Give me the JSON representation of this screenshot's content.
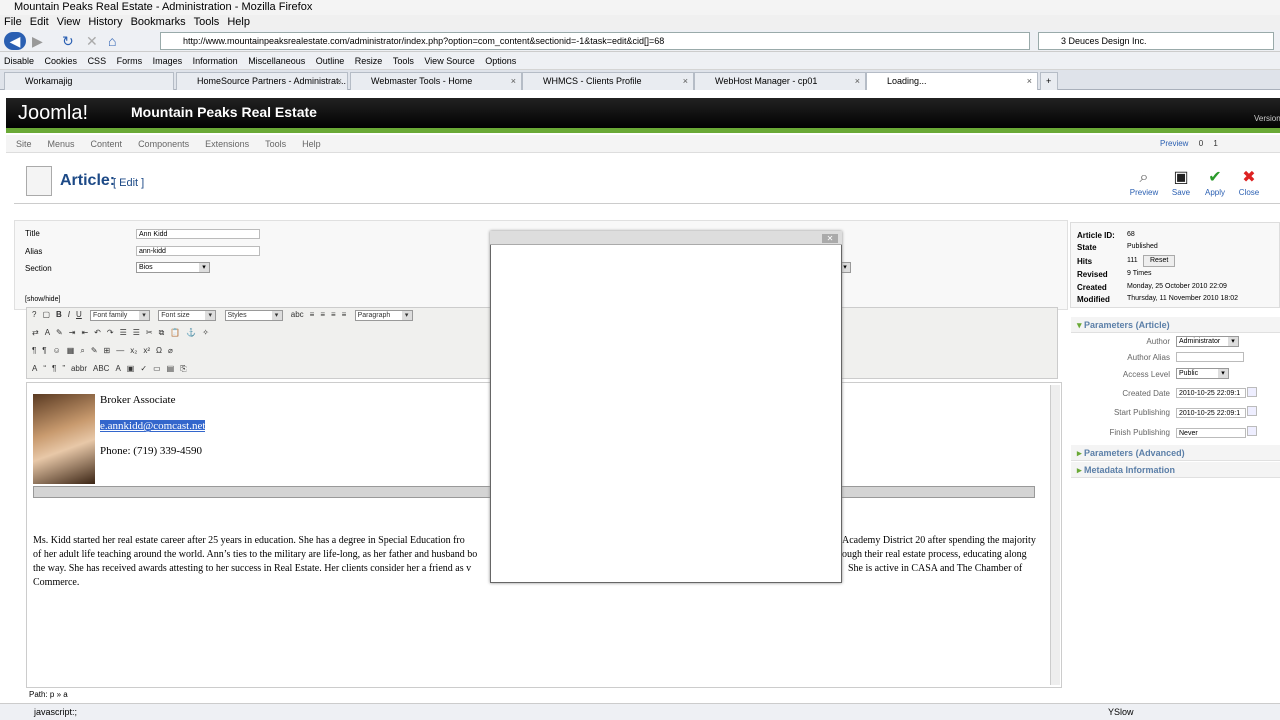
{
  "browser": {
    "title": "Mountain Peaks Real Estate - Administration - Mozilla Firefox",
    "menus": [
      "File",
      "Edit",
      "View",
      "History",
      "Bookmarks",
      "Tools",
      "Help"
    ],
    "url": "http://www.mountainpeaksrealestate.com/administrator/index.php?option=com_content&sectionid=-1&task=edit&cid[]=68",
    "search": "3 Deuces Design Inc.",
    "status_left": "javascript:;",
    "status_right": "YSlow"
  },
  "webdev": [
    "Disable",
    "Cookies",
    "CSS",
    "Forms",
    "Images",
    "Information",
    "Miscellaneous",
    "Outline",
    "Resize",
    "Tools",
    "View Source",
    "Options"
  ],
  "tabs": [
    "Workamajig",
    "HomeSource Partners - Administrat...",
    "Webmaster Tools - Home",
    "WHMCS - Clients Profile",
    "WebHost Manager - cp01",
    "Loading..."
  ],
  "joomla": {
    "logo": "Joomla!",
    "site": "Mountain Peaks Real Estate",
    "version": "Version",
    "menu": [
      "Site",
      "Menus",
      "Content",
      "Components",
      "Extensions",
      "Tools",
      "Help"
    ],
    "status": [
      "Preview",
      "0",
      "1"
    ]
  },
  "page": {
    "title": "Article:",
    "edit": "[ Edit ]",
    "buttons": [
      "Preview",
      "Save",
      "Apply",
      "Close"
    ]
  },
  "form": {
    "title_label": "Title",
    "title_value": "Ann Kidd",
    "alias_label": "Alias",
    "alias_value": "ann-kidd",
    "section_label": "Section",
    "section_value": "Bios",
    "showhide": "[show/hide]"
  },
  "editor": {
    "font_family": "Font family",
    "font_size": "Font size",
    "styles": "Styles",
    "format": "Paragraph",
    "heading": "Broker Associate",
    "email": "e.annkidd@comcast.net",
    "phone": "Phone:  (719) 339-4590",
    "bio1": "Ms. Kidd started her real estate career after 25 years in education.  She has a degree in Special Education fro",
    "bio1r": "Academy District 20 after spending the majority",
    "bio2": "of her adult life teaching around the world.  Ann’s ties to the military are life-long, as her father and husband bo",
    "bio2r": "ough their real estate process, educating along",
    "bio3": "the way. She has received awards attesting to her success in Real Estate.  Her clients consider her a friend as v",
    "bio3r": "She is active in CASA and The Chamber of",
    "bio4": "Commerce.",
    "path": "Path: p » a"
  },
  "details": {
    "id_label": "Article ID:",
    "id": "68",
    "state_label": "State",
    "state": "Published",
    "hits_label": "Hits",
    "hits": "111",
    "reset": "Reset",
    "revised_label": "Revised",
    "revised": "9 Times",
    "created_label": "Created",
    "created": "Monday, 25 October 2010 22:09",
    "modified_label": "Modified",
    "modified": "Thursday, 11 November 2010 18:02"
  },
  "params": {
    "header": "Parameters (Article)",
    "author_label": "Author",
    "author": "Administrator",
    "alias_label": "Author Alias",
    "access_label": "Access Level",
    "access": "Public",
    "created_label": "Created Date",
    "created": "2010-10-25 22:09:1",
    "start_label": "Start Publishing",
    "start": "2010-10-25 22:09:1",
    "finish_label": "Finish Publishing",
    "finish": "Never",
    "advanced": "Parameters (Advanced)",
    "metadata": "Metadata Information"
  }
}
